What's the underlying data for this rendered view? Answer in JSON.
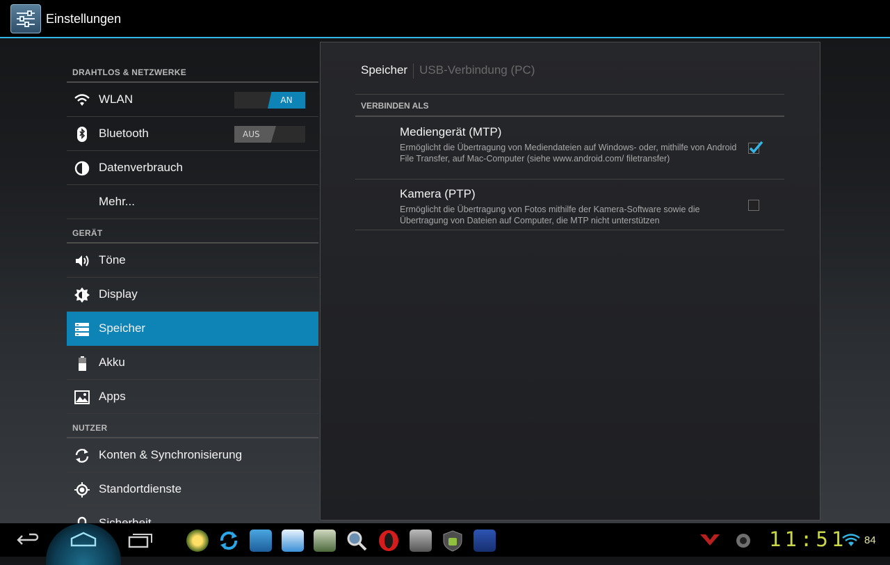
{
  "action_bar": {
    "title": "Einstellungen"
  },
  "sidebar": {
    "sections": [
      {
        "header": "DRAHTLOS & NETZWERKE"
      },
      {
        "header": "GERÄT"
      },
      {
        "header": "NUTZER"
      }
    ],
    "items": [
      {
        "label": "WLAN",
        "icon": "wifi-icon",
        "toggle": "AN"
      },
      {
        "label": "Bluetooth",
        "icon": "bluetooth-icon",
        "toggle": "AUS"
      },
      {
        "label": "Datenverbrauch",
        "icon": "data-usage-icon"
      },
      {
        "label": "Mehr..."
      },
      {
        "label": "Töne",
        "icon": "speaker-icon"
      },
      {
        "label": "Display",
        "icon": "brightness-icon"
      },
      {
        "label": "Speicher",
        "icon": "storage-icon",
        "selected": true
      },
      {
        "label": "Akku",
        "icon": "battery-icon"
      },
      {
        "label": "Apps",
        "icon": "apps-icon"
      },
      {
        "label": "Konten & Synchronisierung",
        "icon": "sync-icon"
      },
      {
        "label": "Standortdienste",
        "icon": "location-icon"
      },
      {
        "label": "Sicherheit",
        "icon": "lock-icon"
      }
    ]
  },
  "detail": {
    "tabs": {
      "active": "Speicher",
      "inactive": "USB-Verbindung (PC)"
    },
    "header": "VERBINDEN ALS",
    "options": [
      {
        "title": "Mediengerät (MTP)",
        "summary": "Ermöglicht die Übertragung von Mediendateien auf Windows- oder, mithilfe von Android File Transfer, auf Mac-Computer (siehe www.android.com/ filetransfer)",
        "checked": true
      },
      {
        "title": "Kamera (PTP)",
        "summary": "Ermöglicht die Übertragung von Fotos mithilfe der Kamera-Software sowie die Übertragung von Dateien auf Computer, die MTP nicht unterstützen",
        "checked": false
      }
    ]
  },
  "status_bar": {
    "time": "11:51",
    "battery": "84"
  },
  "colors": {
    "accent": "#33b5e5",
    "selected": "#0e84b6",
    "clock": "#c9d64a"
  }
}
